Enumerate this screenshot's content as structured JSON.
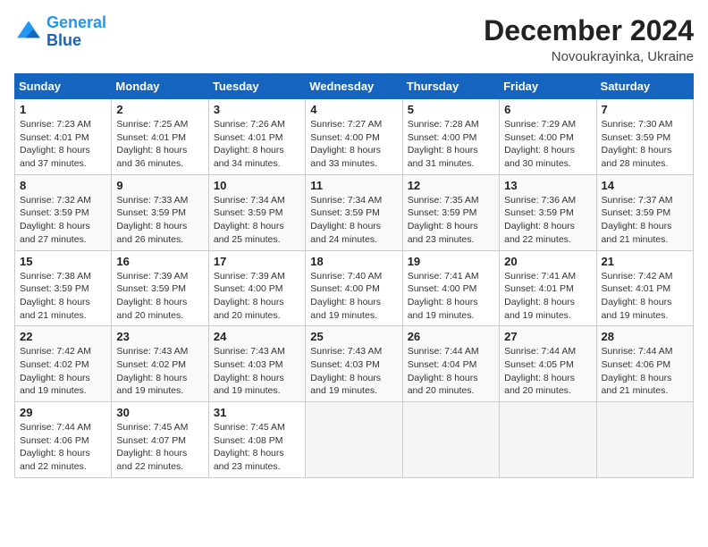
{
  "header": {
    "logo_line1": "General",
    "logo_line2": "Blue",
    "month": "December 2024",
    "location": "Novoukrayinka, Ukraine"
  },
  "weekdays": [
    "Sunday",
    "Monday",
    "Tuesday",
    "Wednesday",
    "Thursday",
    "Friday",
    "Saturday"
  ],
  "weeks": [
    [
      {
        "day": "1",
        "sunrise": "7:23 AM",
        "sunset": "4:01 PM",
        "daylight": "8 hours and 37 minutes."
      },
      {
        "day": "2",
        "sunrise": "7:25 AM",
        "sunset": "4:01 PM",
        "daylight": "8 hours and 36 minutes."
      },
      {
        "day": "3",
        "sunrise": "7:26 AM",
        "sunset": "4:01 PM",
        "daylight": "8 hours and 34 minutes."
      },
      {
        "day": "4",
        "sunrise": "7:27 AM",
        "sunset": "4:00 PM",
        "daylight": "8 hours and 33 minutes."
      },
      {
        "day": "5",
        "sunrise": "7:28 AM",
        "sunset": "4:00 PM",
        "daylight": "8 hours and 31 minutes."
      },
      {
        "day": "6",
        "sunrise": "7:29 AM",
        "sunset": "4:00 PM",
        "daylight": "8 hours and 30 minutes."
      },
      {
        "day": "7",
        "sunrise": "7:30 AM",
        "sunset": "3:59 PM",
        "daylight": "8 hours and 28 minutes."
      }
    ],
    [
      {
        "day": "8",
        "sunrise": "7:32 AM",
        "sunset": "3:59 PM",
        "daylight": "8 hours and 27 minutes."
      },
      {
        "day": "9",
        "sunrise": "7:33 AM",
        "sunset": "3:59 PM",
        "daylight": "8 hours and 26 minutes."
      },
      {
        "day": "10",
        "sunrise": "7:34 AM",
        "sunset": "3:59 PM",
        "daylight": "8 hours and 25 minutes."
      },
      {
        "day": "11",
        "sunrise": "7:34 AM",
        "sunset": "3:59 PM",
        "daylight": "8 hours and 24 minutes."
      },
      {
        "day": "12",
        "sunrise": "7:35 AM",
        "sunset": "3:59 PM",
        "daylight": "8 hours and 23 minutes."
      },
      {
        "day": "13",
        "sunrise": "7:36 AM",
        "sunset": "3:59 PM",
        "daylight": "8 hours and 22 minutes."
      },
      {
        "day": "14",
        "sunrise": "7:37 AM",
        "sunset": "3:59 PM",
        "daylight": "8 hours and 21 minutes."
      }
    ],
    [
      {
        "day": "15",
        "sunrise": "7:38 AM",
        "sunset": "3:59 PM",
        "daylight": "8 hours and 21 minutes."
      },
      {
        "day": "16",
        "sunrise": "7:39 AM",
        "sunset": "3:59 PM",
        "daylight": "8 hours and 20 minutes."
      },
      {
        "day": "17",
        "sunrise": "7:39 AM",
        "sunset": "4:00 PM",
        "daylight": "8 hours and 20 minutes."
      },
      {
        "day": "18",
        "sunrise": "7:40 AM",
        "sunset": "4:00 PM",
        "daylight": "8 hours and 19 minutes."
      },
      {
        "day": "19",
        "sunrise": "7:41 AM",
        "sunset": "4:00 PM",
        "daylight": "8 hours and 19 minutes."
      },
      {
        "day": "20",
        "sunrise": "7:41 AM",
        "sunset": "4:01 PM",
        "daylight": "8 hours and 19 minutes."
      },
      {
        "day": "21",
        "sunrise": "7:42 AM",
        "sunset": "4:01 PM",
        "daylight": "8 hours and 19 minutes."
      }
    ],
    [
      {
        "day": "22",
        "sunrise": "7:42 AM",
        "sunset": "4:02 PM",
        "daylight": "8 hours and 19 minutes."
      },
      {
        "day": "23",
        "sunrise": "7:43 AM",
        "sunset": "4:02 PM",
        "daylight": "8 hours and 19 minutes."
      },
      {
        "day": "24",
        "sunrise": "7:43 AM",
        "sunset": "4:03 PM",
        "daylight": "8 hours and 19 minutes."
      },
      {
        "day": "25",
        "sunrise": "7:43 AM",
        "sunset": "4:03 PM",
        "daylight": "8 hours and 19 minutes."
      },
      {
        "day": "26",
        "sunrise": "7:44 AM",
        "sunset": "4:04 PM",
        "daylight": "8 hours and 20 minutes."
      },
      {
        "day": "27",
        "sunrise": "7:44 AM",
        "sunset": "4:05 PM",
        "daylight": "8 hours and 20 minutes."
      },
      {
        "day": "28",
        "sunrise": "7:44 AM",
        "sunset": "4:06 PM",
        "daylight": "8 hours and 21 minutes."
      }
    ],
    [
      {
        "day": "29",
        "sunrise": "7:44 AM",
        "sunset": "4:06 PM",
        "daylight": "8 hours and 22 minutes."
      },
      {
        "day": "30",
        "sunrise": "7:45 AM",
        "sunset": "4:07 PM",
        "daylight": "8 hours and 22 minutes."
      },
      {
        "day": "31",
        "sunrise": "7:45 AM",
        "sunset": "4:08 PM",
        "daylight": "8 hours and 23 minutes."
      },
      null,
      null,
      null,
      null
    ]
  ]
}
